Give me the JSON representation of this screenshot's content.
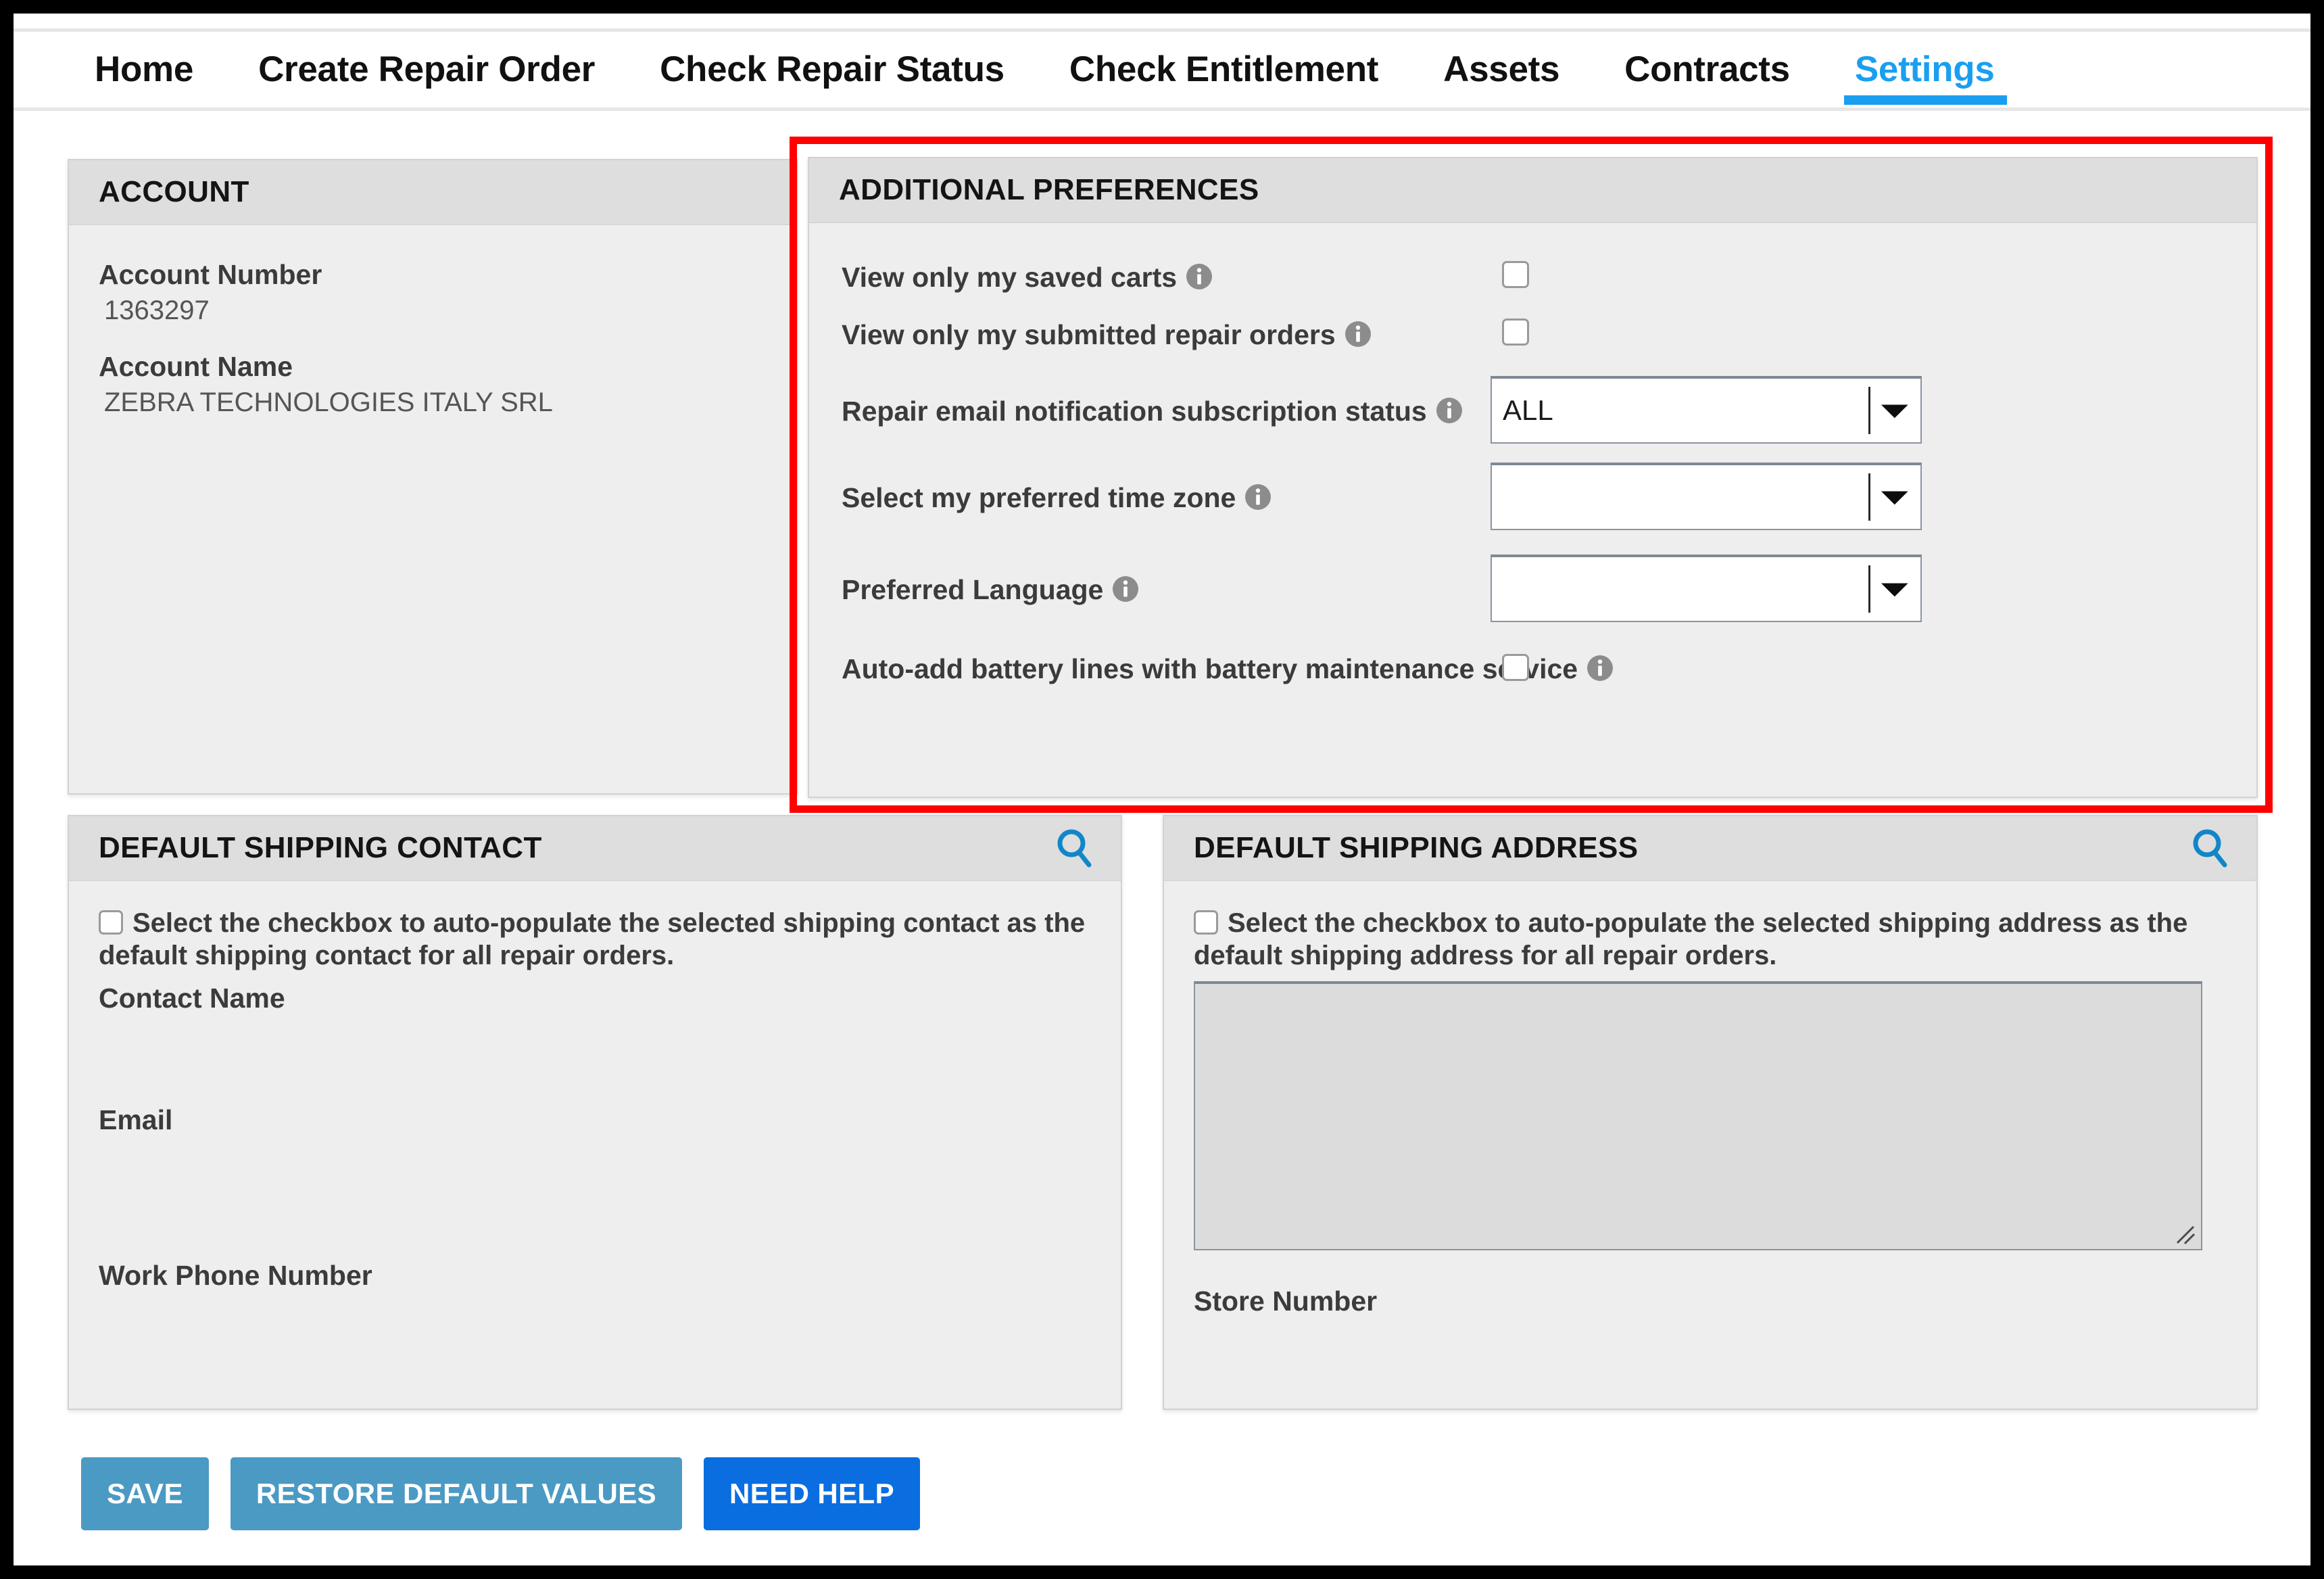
{
  "nav": {
    "items": [
      {
        "label": "Home",
        "active": false
      },
      {
        "label": "Create Repair Order",
        "active": false
      },
      {
        "label": "Check Repair Status",
        "active": false
      },
      {
        "label": "Check Entitlement",
        "active": false
      },
      {
        "label": "Assets",
        "active": false
      },
      {
        "label": "Contracts",
        "active": false
      },
      {
        "label": "Settings",
        "active": true
      }
    ],
    "active_color": "#1a9ff0"
  },
  "account": {
    "title": "ACCOUNT",
    "account_number_label": "Account Number",
    "account_number_value": "1363297",
    "account_name_label": "Account Name",
    "account_name_value": "ZEBRA TECHNOLOGIES ITALY SRL"
  },
  "preferences": {
    "title": "ADDITIONAL PREFERENCES",
    "highlight_color": "#ff0000",
    "rows": [
      {
        "label": "View only my saved carts",
        "control": "checkbox",
        "checked": false,
        "info": true
      },
      {
        "label": "View only my submitted repair orders",
        "control": "checkbox",
        "checked": false,
        "info": true
      },
      {
        "label": "Repair email notification subscription status",
        "control": "dropdown",
        "value": "ALL",
        "info": true
      },
      {
        "label": "Select my preferred time zone",
        "control": "dropdown",
        "value": "",
        "info": true
      },
      {
        "label": "Preferred Language",
        "control": "dropdown",
        "value": "",
        "info": true
      },
      {
        "label": "Auto-add battery lines with battery maintenance service",
        "control": "checkbox",
        "checked": false,
        "info": true
      }
    ]
  },
  "shipping_contact": {
    "title": "DEFAULT SHIPPING CONTACT",
    "search_icon": "search-icon",
    "checkbox_note": "Select the checkbox to auto-populate the selected shipping contact as the default shipping contact for all repair orders.",
    "checked": false,
    "fields": [
      {
        "label": "Contact Name",
        "value": ""
      },
      {
        "label": "Email",
        "value": ""
      },
      {
        "label": "Work Phone Number",
        "value": ""
      }
    ]
  },
  "shipping_address": {
    "title": "DEFAULT SHIPPING ADDRESS",
    "search_icon": "search-icon",
    "checkbox_note": "Select the checkbox to auto-populate the selected shipping address as the default shipping address for all repair orders.",
    "checked": false,
    "address_value": "",
    "store_number_label": "Store Number",
    "store_number_value": ""
  },
  "buttons": [
    {
      "label": "SAVE",
      "style": "secondary"
    },
    {
      "label": "RESTORE DEFAULT VALUES",
      "style": "secondary"
    },
    {
      "label": "NEED HELP",
      "style": "primary"
    }
  ]
}
